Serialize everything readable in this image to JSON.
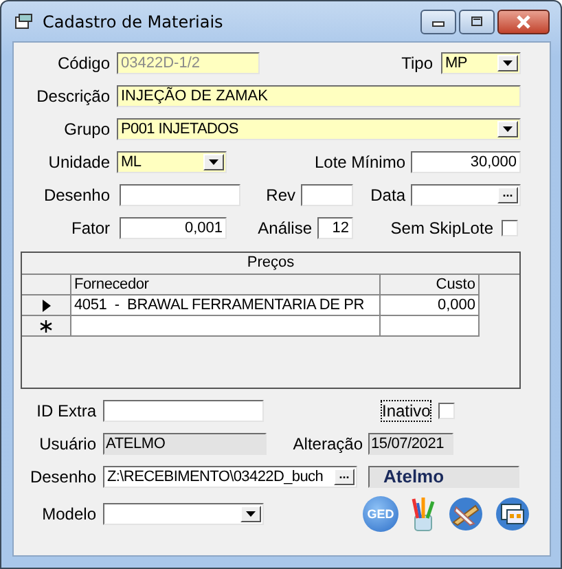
{
  "window": {
    "title": "Cadastro de Materiais"
  },
  "codigo": {
    "label": "Código",
    "value": "03422D-1/2",
    "disabled": true
  },
  "tipo": {
    "label": "Tipo",
    "value": "MP"
  },
  "descricao": {
    "label": "Descrição",
    "value": "INJEÇÃO DE ZAMAK"
  },
  "grupo": {
    "label": "Grupo",
    "value": "P001 INJETADOS"
  },
  "unidade": {
    "label": "Unidade",
    "value": "ML"
  },
  "lote_minimo": {
    "label": "Lote Mínimo",
    "value": "30,000"
  },
  "desenho": {
    "label": "Desenho"
  },
  "rev": {
    "label": "Rev"
  },
  "data": {
    "label": "Data",
    "button": "..."
  },
  "fator": {
    "label": "Fator",
    "value": "0,001"
  },
  "analise": {
    "label": "Análise",
    "value": "12"
  },
  "sem_skiplote": {
    "label": "Sem SkipLote",
    "checked": false
  },
  "precos": {
    "title": "Preços",
    "columns": [
      "Fornecedor",
      "Custo"
    ],
    "rows": [
      {
        "kind": "current",
        "cells": [
          "4051  -  BRAWAL FERRAMENTARIA DE PR",
          "0,000"
        ]
      },
      {
        "kind": "new"
      }
    ]
  },
  "id_extra": {
    "label": "ID Extra"
  },
  "inativo": {
    "label": "Inativo",
    "checked": false,
    "focused": true
  },
  "usuario": {
    "label": "Usuário",
    "value": "ATELMO"
  },
  "alteracao": {
    "label": "Alteração",
    "value": "15/07/2021"
  },
  "desenho_arquivo": {
    "label": "Desenho",
    "value": "Z:\\RECEBIMENTO\\03422D_buch",
    "button": "..."
  },
  "responsavel": {
    "value": "Atelmo"
  },
  "modelo": {
    "label": "Modelo"
  },
  "toolbar": [
    {
      "kind": "ged",
      "label": "GED"
    },
    {
      "kind": "paint"
    },
    {
      "kind": "ruler"
    },
    {
      "kind": "window"
    }
  ]
}
